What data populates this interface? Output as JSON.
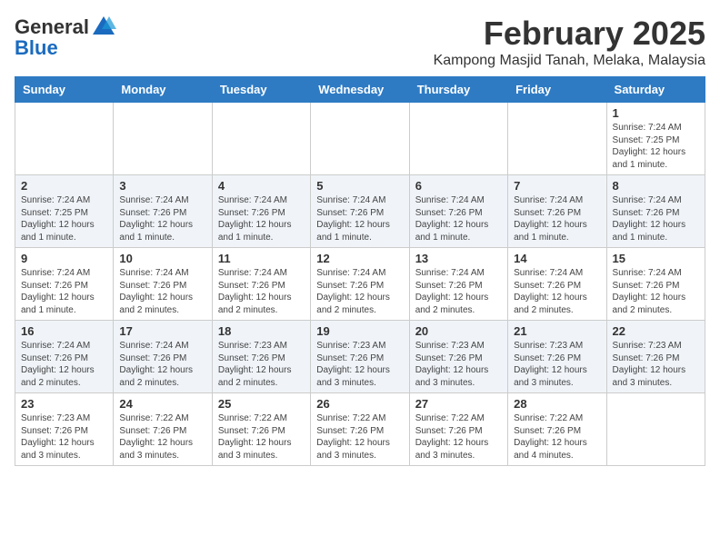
{
  "header": {
    "logo": {
      "general": "General",
      "blue": "Blue"
    },
    "title": "February 2025",
    "subtitle": "Kampong Masjid Tanah, Melaka, Malaysia"
  },
  "days_of_week": [
    "Sunday",
    "Monday",
    "Tuesday",
    "Wednesday",
    "Thursday",
    "Friday",
    "Saturday"
  ],
  "weeks": [
    [
      {
        "day": "",
        "info": ""
      },
      {
        "day": "",
        "info": ""
      },
      {
        "day": "",
        "info": ""
      },
      {
        "day": "",
        "info": ""
      },
      {
        "day": "",
        "info": ""
      },
      {
        "day": "",
        "info": ""
      },
      {
        "day": "1",
        "info": "Sunrise: 7:24 AM\nSunset: 7:25 PM\nDaylight: 12 hours and 1 minute."
      }
    ],
    [
      {
        "day": "2",
        "info": "Sunrise: 7:24 AM\nSunset: 7:25 PM\nDaylight: 12 hours and 1 minute."
      },
      {
        "day": "3",
        "info": "Sunrise: 7:24 AM\nSunset: 7:26 PM\nDaylight: 12 hours and 1 minute."
      },
      {
        "day": "4",
        "info": "Sunrise: 7:24 AM\nSunset: 7:26 PM\nDaylight: 12 hours and 1 minute."
      },
      {
        "day": "5",
        "info": "Sunrise: 7:24 AM\nSunset: 7:26 PM\nDaylight: 12 hours and 1 minute."
      },
      {
        "day": "6",
        "info": "Sunrise: 7:24 AM\nSunset: 7:26 PM\nDaylight: 12 hours and 1 minute."
      },
      {
        "day": "7",
        "info": "Sunrise: 7:24 AM\nSunset: 7:26 PM\nDaylight: 12 hours and 1 minute."
      },
      {
        "day": "8",
        "info": "Sunrise: 7:24 AM\nSunset: 7:26 PM\nDaylight: 12 hours and 1 minute."
      }
    ],
    [
      {
        "day": "9",
        "info": "Sunrise: 7:24 AM\nSunset: 7:26 PM\nDaylight: 12 hours and 1 minute."
      },
      {
        "day": "10",
        "info": "Sunrise: 7:24 AM\nSunset: 7:26 PM\nDaylight: 12 hours and 2 minutes."
      },
      {
        "day": "11",
        "info": "Sunrise: 7:24 AM\nSunset: 7:26 PM\nDaylight: 12 hours and 2 minutes."
      },
      {
        "day": "12",
        "info": "Sunrise: 7:24 AM\nSunset: 7:26 PM\nDaylight: 12 hours and 2 minutes."
      },
      {
        "day": "13",
        "info": "Sunrise: 7:24 AM\nSunset: 7:26 PM\nDaylight: 12 hours and 2 minutes."
      },
      {
        "day": "14",
        "info": "Sunrise: 7:24 AM\nSunset: 7:26 PM\nDaylight: 12 hours and 2 minutes."
      },
      {
        "day": "15",
        "info": "Sunrise: 7:24 AM\nSunset: 7:26 PM\nDaylight: 12 hours and 2 minutes."
      }
    ],
    [
      {
        "day": "16",
        "info": "Sunrise: 7:24 AM\nSunset: 7:26 PM\nDaylight: 12 hours and 2 minutes."
      },
      {
        "day": "17",
        "info": "Sunrise: 7:24 AM\nSunset: 7:26 PM\nDaylight: 12 hours and 2 minutes."
      },
      {
        "day": "18",
        "info": "Sunrise: 7:23 AM\nSunset: 7:26 PM\nDaylight: 12 hours and 2 minutes."
      },
      {
        "day": "19",
        "info": "Sunrise: 7:23 AM\nSunset: 7:26 PM\nDaylight: 12 hours and 3 minutes."
      },
      {
        "day": "20",
        "info": "Sunrise: 7:23 AM\nSunset: 7:26 PM\nDaylight: 12 hours and 3 minutes."
      },
      {
        "day": "21",
        "info": "Sunrise: 7:23 AM\nSunset: 7:26 PM\nDaylight: 12 hours and 3 minutes."
      },
      {
        "day": "22",
        "info": "Sunrise: 7:23 AM\nSunset: 7:26 PM\nDaylight: 12 hours and 3 minutes."
      }
    ],
    [
      {
        "day": "23",
        "info": "Sunrise: 7:23 AM\nSunset: 7:26 PM\nDaylight: 12 hours and 3 minutes."
      },
      {
        "day": "24",
        "info": "Sunrise: 7:22 AM\nSunset: 7:26 PM\nDaylight: 12 hours and 3 minutes."
      },
      {
        "day": "25",
        "info": "Sunrise: 7:22 AM\nSunset: 7:26 PM\nDaylight: 12 hours and 3 minutes."
      },
      {
        "day": "26",
        "info": "Sunrise: 7:22 AM\nSunset: 7:26 PM\nDaylight: 12 hours and 3 minutes."
      },
      {
        "day": "27",
        "info": "Sunrise: 7:22 AM\nSunset: 7:26 PM\nDaylight: 12 hours and 3 minutes."
      },
      {
        "day": "28",
        "info": "Sunrise: 7:22 AM\nSunset: 7:26 PM\nDaylight: 12 hours and 4 minutes."
      },
      {
        "day": "",
        "info": ""
      }
    ]
  ]
}
